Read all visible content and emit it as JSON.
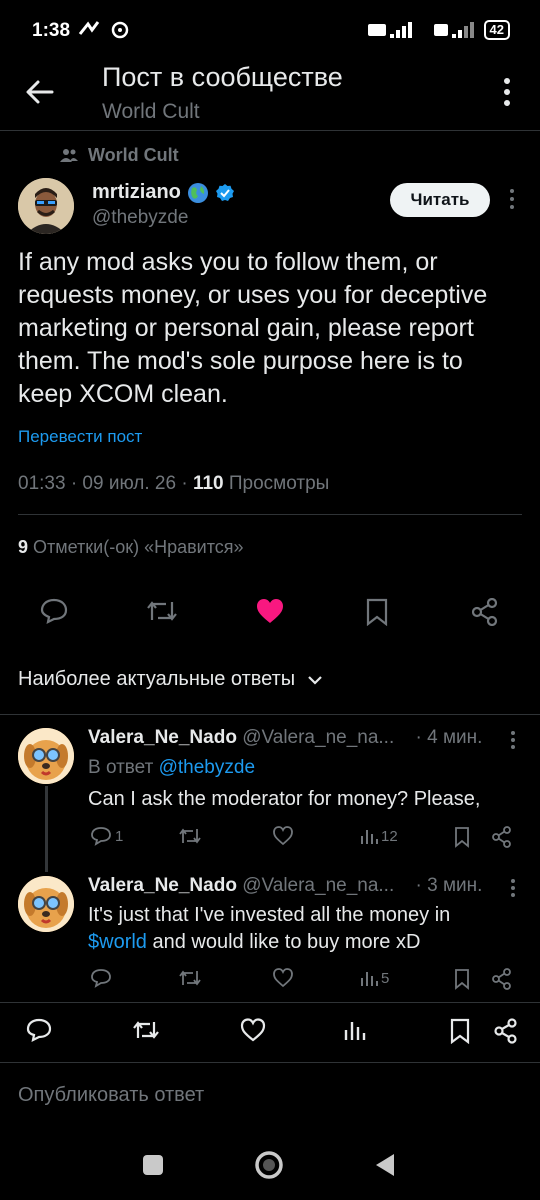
{
  "status_bar": {
    "time": "1:38",
    "battery": "42"
  },
  "header": {
    "title": "Пост в сообществе",
    "subtitle": "World Cult"
  },
  "post": {
    "community": "World Cult",
    "author_name": "mrtiziano",
    "author_handle": "@thebyzde",
    "follow_label": "Читать",
    "text": "If any mod asks you to follow them, or requests money, or uses you for deceptive marketing or personal gain, please report them. The mod's sole purpose here is to keep XCOM clean.",
    "translate_label": "Перевести пост",
    "time_date": "01:33 · 09 июл. 26 · ",
    "views_count": "110",
    "views_label": " Просмотры",
    "likes_count": "9",
    "likes_label": " Отметки(-ок) «Нравится»",
    "liked": true,
    "like_color": "#f91880"
  },
  "replies_sort": {
    "label": "Наиболее актуальные ответы"
  },
  "replies": [
    {
      "name": "Valera_Ne_Nado",
      "handle": "@Valera_ne_na...",
      "time": "· 4 мин.",
      "reply_to_prefix": "В ответ ",
      "reply_to": "@thebyzde",
      "text": "Can I ask the moderator for money? Please,",
      "reply_count": "1",
      "views": "12"
    },
    {
      "name": "Valera_Ne_Nado",
      "handle": "@Valera_ne_na...",
      "time": "· 3 мин.",
      "text_pre": "It's just that I've invested all the money in",
      "text_link": "$world",
      "text_post": " and would like to buy more xD",
      "views": "5"
    }
  ],
  "composer": {
    "placeholder": "Опубликовать ответ"
  },
  "colors": {
    "accent": "#1d9bf0",
    "like": "#f91880",
    "muted": "#71767b"
  }
}
